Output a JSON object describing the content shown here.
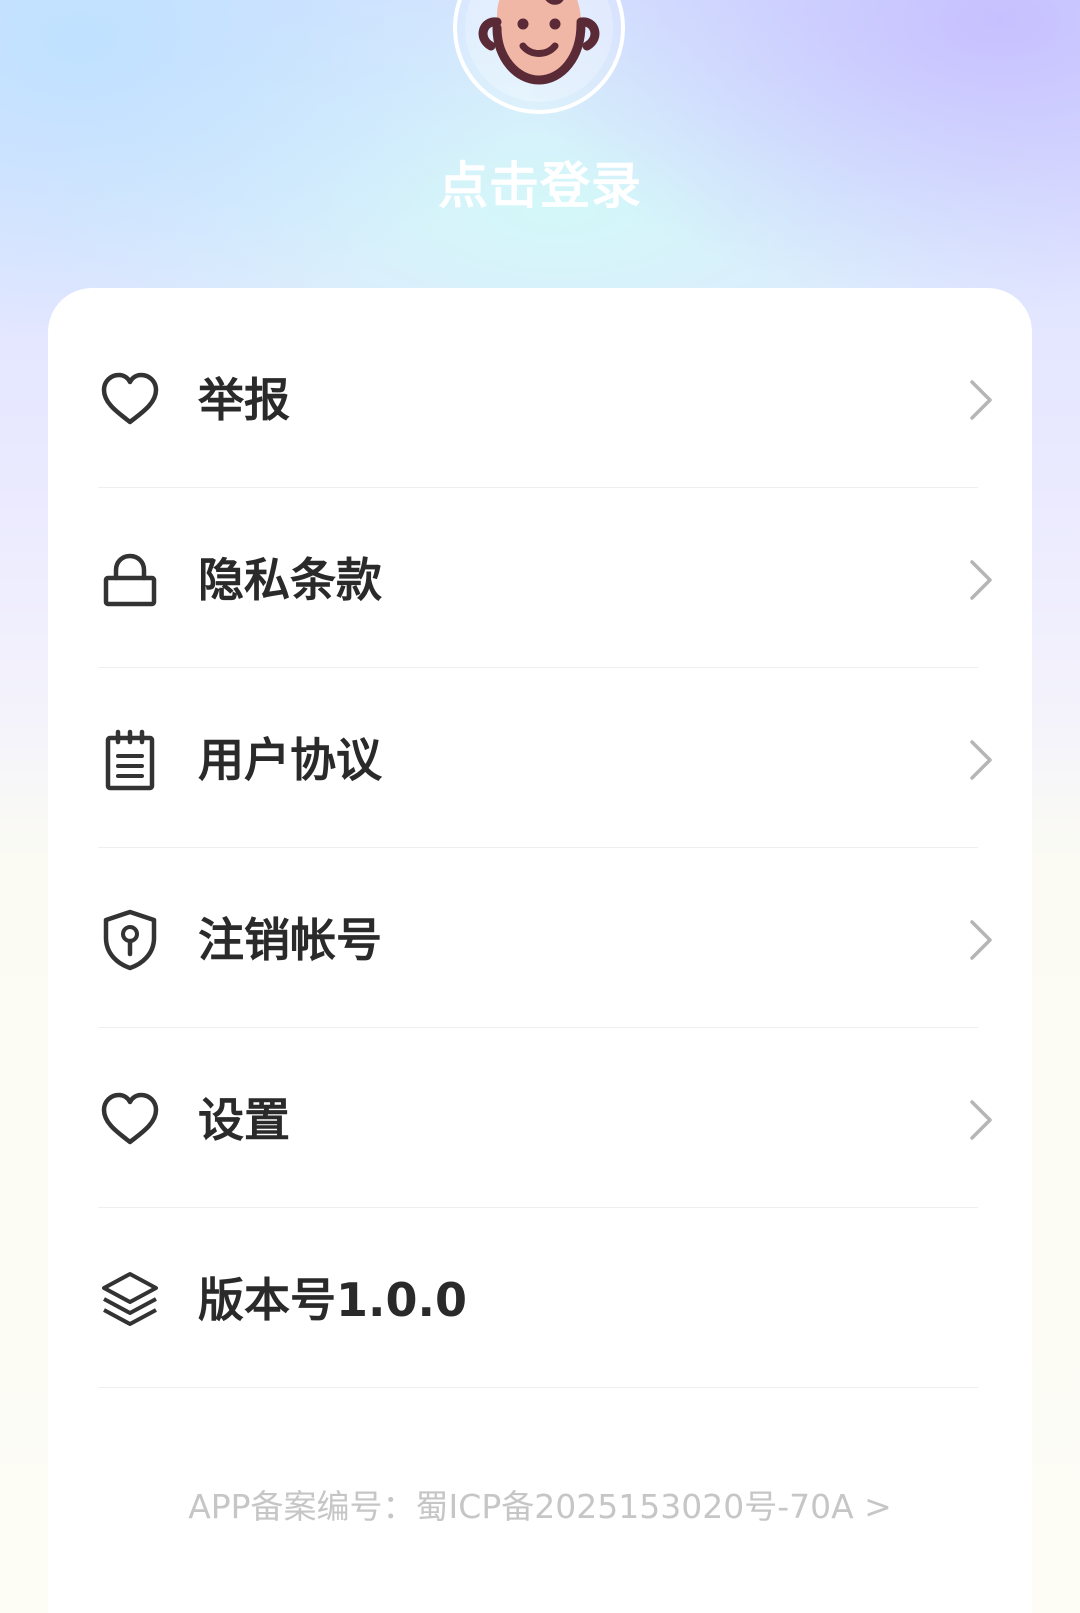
{
  "profile": {
    "login_text": "点击登录"
  },
  "menu": {
    "items": [
      {
        "label": "举报",
        "icon": "heart-icon"
      },
      {
        "label": "隐私条款",
        "icon": "lock-icon"
      },
      {
        "label": "用户协议",
        "icon": "notepad-icon"
      },
      {
        "label": "注销帐号",
        "icon": "shield-keyhole-icon"
      },
      {
        "label": "设置",
        "icon": "heart-icon"
      },
      {
        "label": "版本号1.0.0",
        "icon": "layers-icon"
      }
    ]
  },
  "footer": {
    "icp_text": "APP备案编号：蜀ICP备2025153020号-70A >"
  },
  "colors": {
    "text_primary": "#2a2a2a",
    "icon": "#333333",
    "chevron": "#b5b5b5",
    "footer_text": "#c6c6c6",
    "avatar_face": "#f0b7a6",
    "avatar_outline": "#5a2a36"
  }
}
